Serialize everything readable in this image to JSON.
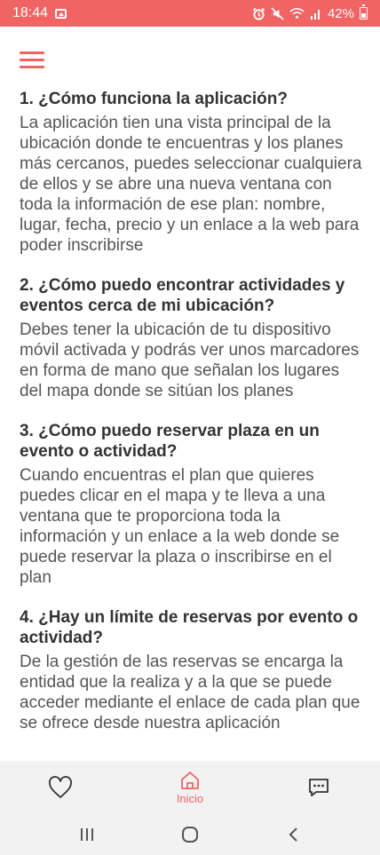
{
  "status_bar": {
    "time": "18:44",
    "battery": "42%",
    "icons": [
      "image-icon",
      "alarm-icon",
      "mute-icon",
      "wifi-icon",
      "signal-icon",
      "battery-icon"
    ]
  },
  "colors": {
    "accent": "#f06464",
    "text": "#333333",
    "answer": "#555555",
    "nav_bg": "#f2f2f2"
  },
  "faq": [
    {
      "question": "1. ¿Cómo funciona la aplicación?",
      "answer": "La aplicación tien una vista principal de la ubicación donde te encuentras y los planes más cercanos, puedes seleccionar cualquiera de ellos y se abre una nueva ventana con toda la información de ese plan: nombre, lugar, fecha, precio y un enlace a la web para poder inscribirse"
    },
    {
      "question": "2. ¿Cómo puedo encontrar actividades y eventos cerca de mi ubicación?",
      "answer": "Debes tener la ubicación de tu dispositivo móvil activada y podrás ver unos marcadores en forma de mano que señalan los lugares del mapa donde se sitúan los planes"
    },
    {
      "question": "3. ¿Cómo puedo reservar plaza en un evento o actividad?",
      "answer": "Cuando encuentras el plan que quieres puedes clicar en el mapa y te lleva a una ventana que te proporciona toda la información y un enlace a la web donde se puede reservar la plaza o inscribirse en el plan"
    },
    {
      "question": "4. ¿Hay un límite de reservas por evento o actividad?",
      "answer": "De la gestión de las reservas se encarga la entidad que la realiza y a la que se puede acceder mediante el enlace de cada plan que se ofrece desde nuestra aplicación"
    }
  ],
  "bottom_nav": {
    "favorites_icon": "heart-icon",
    "home_label": "Inicio",
    "home_icon": "home-icon",
    "messages_icon": "chat-icon"
  }
}
